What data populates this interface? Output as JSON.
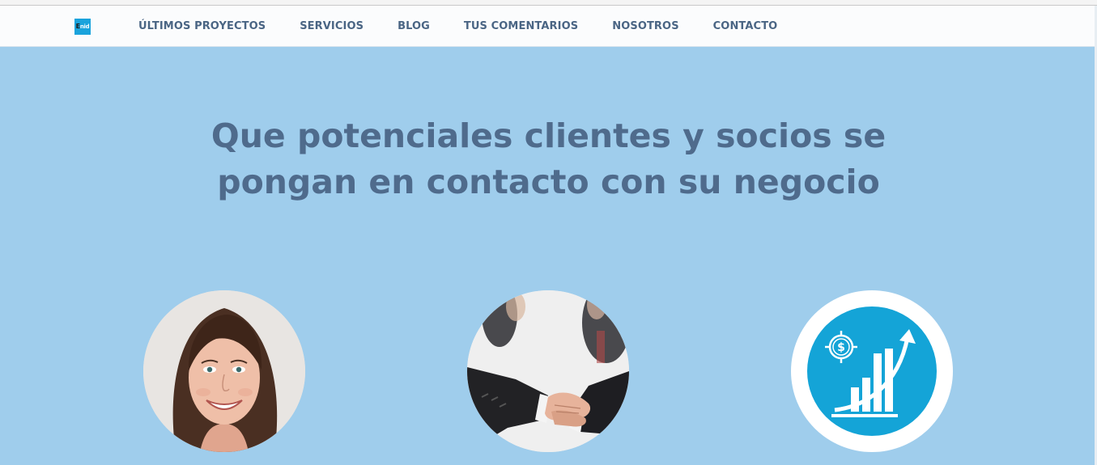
{
  "nav": {
    "logo_lead": "E",
    "logo_rest": "nid",
    "items": [
      {
        "label": "ÚLTIMOS PROYECTOS"
      },
      {
        "label": "SERVICIOS"
      },
      {
        "label": "BLOG"
      },
      {
        "label": "TUS COMENTARIOS"
      },
      {
        "label": "NOSOTROS"
      },
      {
        "label": "CONTACTO"
      }
    ]
  },
  "hero": {
    "title_line1": "Que potenciales clientes y socios se",
    "title_line2": "pongan en contacto con su negocio"
  },
  "features": [
    {
      "image": "woman-portrait"
    },
    {
      "image": "handshake-photo"
    },
    {
      "image": "growth-chart-icon"
    }
  ],
  "colors": {
    "background": "#9fcdec",
    "nav_text": "#4a6584",
    "title_text": "#4f6b8c",
    "accent": "#14a4d7"
  }
}
